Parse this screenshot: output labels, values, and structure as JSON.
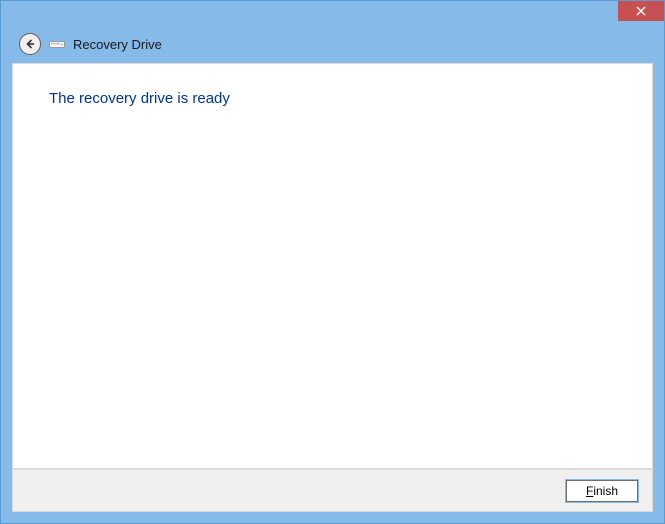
{
  "titlebar": {
    "close_label": "Close"
  },
  "header": {
    "back_label": "Back",
    "wizard_title": "Recovery Drive"
  },
  "content": {
    "heading": "The recovery drive is ready"
  },
  "footer": {
    "finish_label": "Finish",
    "finish_access_prefix": "F",
    "finish_access_rest": "inish"
  }
}
